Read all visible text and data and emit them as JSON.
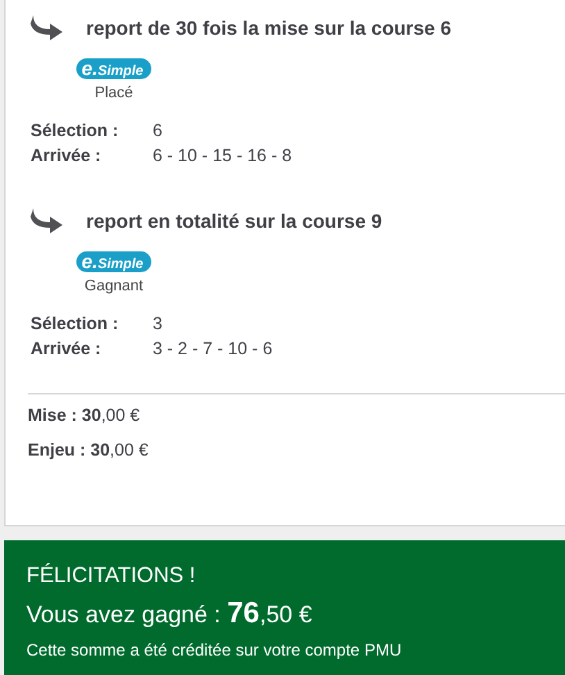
{
  "reports": [
    {
      "title": "report de 30 fois la mise sur la course 6",
      "badge": {
        "prefix": "e.",
        "name": "Simple"
      },
      "bet_type": "Placé",
      "details": [
        {
          "label": "Sélection :",
          "value": "6"
        },
        {
          "label": "Arrivée :",
          "value": "6 - 10 - 15 - 16 - 8"
        }
      ]
    },
    {
      "title": "report en totalité sur la course 9",
      "badge": {
        "prefix": "e.",
        "name": "Simple"
      },
      "bet_type": "Gagnant",
      "details": [
        {
          "label": "Sélection :",
          "value": "3"
        },
        {
          "label": "Arrivée :",
          "value": "3 - 2 - 7 - 10 - 6"
        }
      ]
    }
  ],
  "totals": [
    "**Mise : 30**,00 €",
    "**Enjeu : 30**,00 €"
  ],
  "banner": {
    "heading": "FÉLICITATIONS !",
    "amount": "Vous avez gagné : **76**,50 €",
    "note": "Cette somme a été créditée sur votre compte PMU"
  }
}
